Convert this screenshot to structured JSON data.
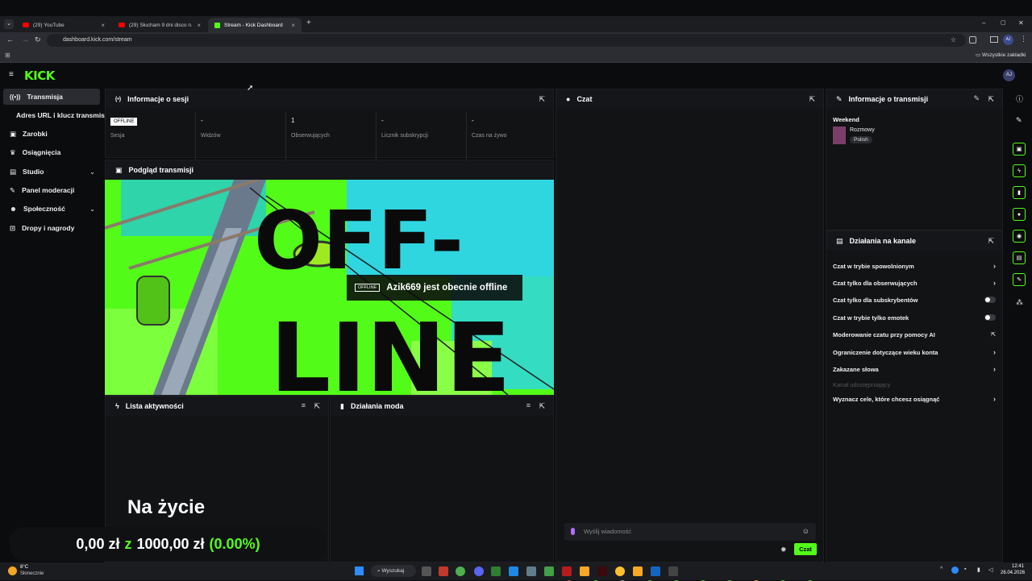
{
  "browser": {
    "tabs": [
      {
        "title": "(29) YouTube"
      },
      {
        "title": "(29) Słucham 9 dni disco n..."
      },
      {
        "title": "Stream - Kick Dashboard"
      }
    ],
    "new_tab": "+",
    "url": "dashboard.kick.com/stream",
    "bookmarks_label": "Wszystkie zakładki",
    "window_controls": [
      "–",
      "▢",
      "✕"
    ]
  },
  "app": {
    "logo": "KICK",
    "avatar": "AJ"
  },
  "sidebar": {
    "items": [
      {
        "label": "Transmisja",
        "icon": "broadcast-icon",
        "active": true
      },
      {
        "label": "Adres URL i klucz transmisji",
        "icon": "",
        "sub": true
      },
      {
        "label": "Zarobki",
        "icon": "earnings-icon"
      },
      {
        "label": "Osiągnięcia",
        "icon": "trophy-icon"
      },
      {
        "label": "Studio",
        "icon": "studio-icon",
        "chevron": true
      },
      {
        "label": "Panel moderacji",
        "icon": "wrench-icon"
      },
      {
        "label": "Społeczność",
        "icon": "community-icon",
        "chevron": true
      },
      {
        "label": "Dropy i nagrody",
        "icon": "gift-icon"
      }
    ]
  },
  "session": {
    "title": "Informacje o sesji",
    "stats": [
      {
        "value": "OFFLINE",
        "label": "Sesja"
      },
      {
        "value": "-",
        "label": "Widzów"
      },
      {
        "value": "1",
        "label": "Obserwujących"
      },
      {
        "value": "-",
        "label": "Licznik subskrypcji"
      },
      {
        "value": "-",
        "label": "Czas na żywo"
      }
    ]
  },
  "preview": {
    "title": "Podgląd transmisji",
    "big_text_1": "OFF-",
    "big_text_2": "LINE",
    "badge": "OFFLINE",
    "message": "Azik669 jest obecnie offline"
  },
  "activity": {
    "title": "Lista aktywności"
  },
  "modactions": {
    "title": "Działania moda"
  },
  "overlay": {
    "title": "Na życie",
    "current": "0,00 zł",
    "sep": "z",
    "goal": "1000,00 zł",
    "percent": "(0.00%)"
  },
  "chat": {
    "title": "Czat",
    "placeholder": "Wyślij wiadomość",
    "send": "Czat"
  },
  "streaminfo": {
    "title": "Informacje o transmisji",
    "stream_title": "Weekend",
    "category": "Rozmowy",
    "language": "Polish"
  },
  "channel_actions": {
    "title": "Działania na kanale",
    "items": [
      {
        "label": "Czat w trybie spowolnionym",
        "control": "arrow"
      },
      {
        "label": "Czat tylko dla obserwujących",
        "control": "arrow"
      },
      {
        "label": "Czat tylko dla subskrybentów",
        "control": "toggle"
      },
      {
        "label": "Czat w trybie tylko emotek",
        "control": "toggle"
      },
      {
        "label": "Moderowanie czatu przy pomocy AI",
        "control": "external"
      },
      {
        "label": "Ograniczenie dotyczące wieku konta",
        "control": "arrow"
      },
      {
        "label": "Zakazane słowa",
        "control": "arrow"
      },
      {
        "label": "Kanał udostępniający",
        "control": "disabled"
      },
      {
        "label": "Wyznacz cele, które chcesz osiągnąć",
        "control": "arrow"
      }
    ]
  },
  "taskbar": {
    "weather_temp": "8°C",
    "weather_desc": "Słonecznie",
    "search": "Wyszukaj",
    "time": "12:41",
    "date": "26.04.2026"
  },
  "colors": {
    "accent": "#53fc18",
    "bg": "#0b0c0e",
    "panel": "#121315"
  }
}
